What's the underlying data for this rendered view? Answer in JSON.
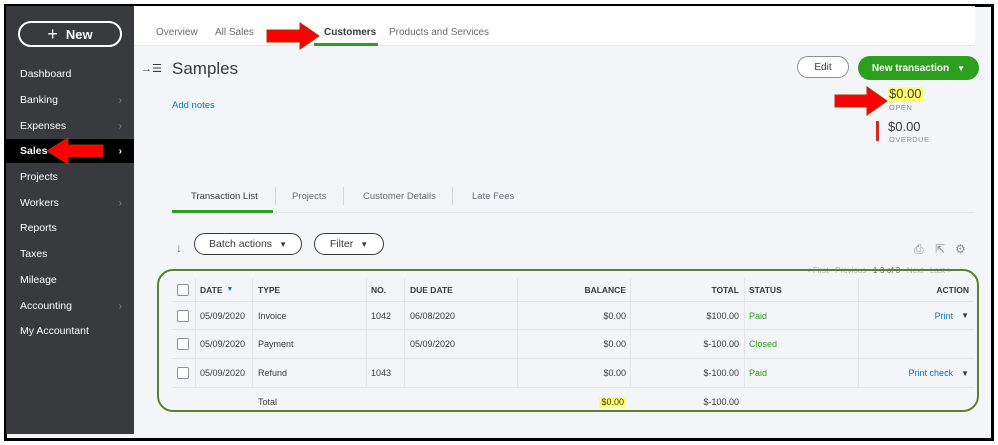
{
  "sidebar": {
    "new_label": "New",
    "items": [
      {
        "label": "Dashboard",
        "chevron": false
      },
      {
        "label": "Banking",
        "chevron": true
      },
      {
        "label": "Expenses",
        "chevron": true
      },
      {
        "label": "Sales",
        "chevron": true,
        "active": true
      },
      {
        "label": "Projects",
        "chevron": false
      },
      {
        "label": "Workers",
        "chevron": true
      },
      {
        "label": "Reports",
        "chevron": false
      },
      {
        "label": "Taxes",
        "chevron": false
      },
      {
        "label": "Mileage",
        "chevron": false
      },
      {
        "label": "Accounting",
        "chevron": true
      },
      {
        "label": "My Accountant",
        "chevron": false
      }
    ]
  },
  "top_tabs": [
    "Overview",
    "All Sales",
    "Customers",
    "Products and Services"
  ],
  "customer": {
    "name": "Samples",
    "add_notes": "Add notes",
    "edit_label": "Edit",
    "new_transaction_label": "New transaction",
    "open_amount": "$0.00",
    "open_label": "OPEN",
    "overdue_amount": "$0.00",
    "overdue_label": "OVERDUE"
  },
  "sub_tabs": [
    "Transaction List",
    "Projects",
    "Customer Details",
    "Late Fees"
  ],
  "toolbar": {
    "batch_label": "Batch actions",
    "filter_label": "Filter"
  },
  "pager": {
    "first": "< First",
    "previous": "Previous",
    "range": "1-3 of 3",
    "next": "Next",
    "last": "Last >"
  },
  "table": {
    "headers": {
      "date": "DATE",
      "type": "TYPE",
      "no": "NO.",
      "due_date": "DUE DATE",
      "balance": "BALANCE",
      "total": "TOTAL",
      "status": "STATUS",
      "action": "ACTION"
    },
    "rows": [
      {
        "date": "05/09/2020",
        "type": "Invoice",
        "no": "1042",
        "due_date": "06/08/2020",
        "balance": "$0.00",
        "total": "$100.00",
        "status": "Paid",
        "action": "Print"
      },
      {
        "date": "05/09/2020",
        "type": "Payment",
        "no": "",
        "due_date": "05/09/2020",
        "balance": "$0.00",
        "total": "$-100.00",
        "status": "Closed",
        "action": ""
      },
      {
        "date": "05/09/2020",
        "type": "Refund",
        "no": "1043",
        "due_date": "",
        "balance": "$0.00",
        "total": "$-100.00",
        "status": "Paid",
        "action": "Print check"
      }
    ],
    "total_row": {
      "label": "Total",
      "balance": "$0.00",
      "total": "$-100.00"
    }
  },
  "colors": {
    "sidebar_bg": "#393a3d",
    "accent_green": "#2ca01c",
    "link_blue": "#0077c5",
    "overdue_red": "#d52b1e",
    "highlight_yellow": "#ffff66",
    "annotation_arrow": "#ff0000"
  },
  "icons": {
    "collapse": "collapse-panel-icon",
    "sort": "sort-arrow-icon",
    "print": "print-icon",
    "export": "export-icon",
    "settings": "gear-icon"
  }
}
